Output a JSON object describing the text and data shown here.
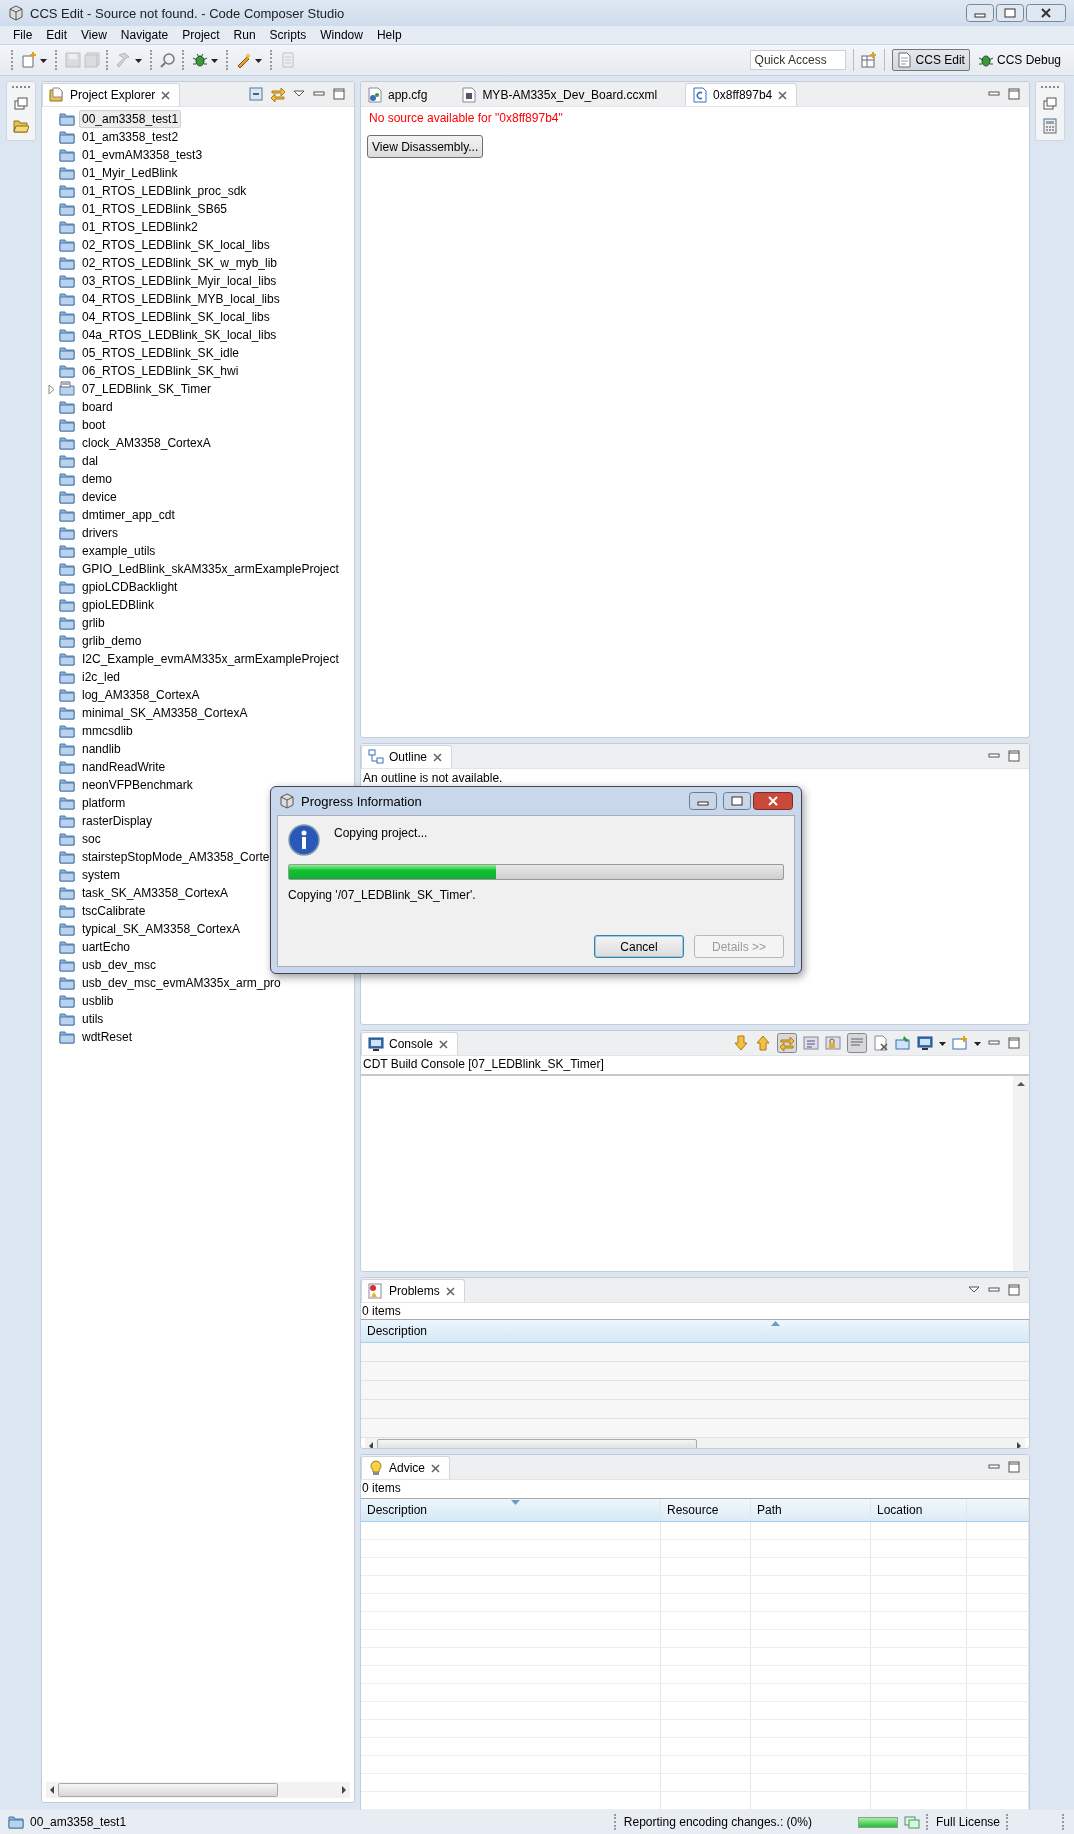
{
  "window": {
    "title": "CCS Edit - Source not found. - Code Composer Studio"
  },
  "menu": [
    "File",
    "Edit",
    "View",
    "Navigate",
    "Project",
    "Run",
    "Scripts",
    "Window",
    "Help"
  ],
  "toolbar": {
    "quick_access": {
      "placeholder": "Quick Access"
    },
    "perspectives": [
      {
        "label": "CCS Edit",
        "kind": "edit",
        "selected": true
      },
      {
        "label": "CCS Debug",
        "kind": "debug",
        "selected": false
      }
    ]
  },
  "project_explorer": {
    "title": "Project Explorer",
    "items": [
      {
        "label": "00_am3358_test1",
        "kind": "folder",
        "selected": true
      },
      {
        "label": "01_am3358_test2",
        "kind": "folder",
        "selected": false
      },
      {
        "label": "01_evmAM3358_test3",
        "kind": "folder",
        "selected": false
      },
      {
        "label": "01_Myir_LedBlink",
        "kind": "folder",
        "selected": false
      },
      {
        "label": "01_RTOS_LEDBlink_proc_sdk",
        "kind": "folder",
        "selected": false
      },
      {
        "label": "01_RTOS_LEDBlink_SB65",
        "kind": "folder",
        "selected": false
      },
      {
        "label": "01_RTOS_LEDBlink2",
        "kind": "folder",
        "selected": false
      },
      {
        "label": "02_RTOS_LEDBlink_SK_local_libs",
        "kind": "folder",
        "selected": false
      },
      {
        "label": "02_RTOS_LEDBlink_SK_w_myb_lib",
        "kind": "folder",
        "selected": false
      },
      {
        "label": "03_RTOS_LEDBlink_Myir_local_libs",
        "kind": "folder",
        "selected": false
      },
      {
        "label": "04_RTOS_LEDBlink_MYB_local_libs",
        "kind": "folder",
        "selected": false
      },
      {
        "label": "04_RTOS_LEDBlink_SK_local_libs",
        "kind": "folder",
        "selected": false
      },
      {
        "label": "04a_RTOS_LEDBlink_SK_local_libs",
        "kind": "folder",
        "selected": false
      },
      {
        "label": "05_RTOS_LEDBlink_SK_idle",
        "kind": "folder",
        "selected": false
      },
      {
        "label": "06_RTOS_LEDBlink_SK_hwi",
        "kind": "folder",
        "selected": false
      },
      {
        "label": "07_LEDBlink_SK_Timer",
        "kind": "project",
        "selected": false,
        "expanded": false
      },
      {
        "label": "board",
        "kind": "folder",
        "selected": false
      },
      {
        "label": "boot",
        "kind": "folder",
        "selected": false
      },
      {
        "label": "clock_AM3358_CortexA",
        "kind": "folder",
        "selected": false
      },
      {
        "label": "dal",
        "kind": "folder",
        "selected": false
      },
      {
        "label": "demo",
        "kind": "folder",
        "selected": false
      },
      {
        "label": "device",
        "kind": "folder",
        "selected": false
      },
      {
        "label": "dmtimer_app_cdt",
        "kind": "folder",
        "selected": false
      },
      {
        "label": "drivers",
        "kind": "folder",
        "selected": false
      },
      {
        "label": "example_utils",
        "kind": "folder",
        "selected": false
      },
      {
        "label": "GPIO_LedBlink_skAM335x_armExampleProject",
        "kind": "folder",
        "selected": false
      },
      {
        "label": "gpioLCDBacklight",
        "kind": "folder",
        "selected": false
      },
      {
        "label": "gpioLEDBlink",
        "kind": "folder",
        "selected": false
      },
      {
        "label": "grlib",
        "kind": "folder",
        "selected": false
      },
      {
        "label": "grlib_demo",
        "kind": "folder",
        "selected": false
      },
      {
        "label": "I2C_Example_evmAM335x_armExampleProject",
        "kind": "folder",
        "selected": false
      },
      {
        "label": "i2c_led",
        "kind": "folder",
        "selected": false
      },
      {
        "label": "log_AM3358_CortexA",
        "kind": "folder",
        "selected": false
      },
      {
        "label": "minimal_SK_AM3358_CortexA",
        "kind": "folder",
        "selected": false
      },
      {
        "label": "mmcsdlib",
        "kind": "folder",
        "selected": false
      },
      {
        "label": "nandlib",
        "kind": "folder",
        "selected": false
      },
      {
        "label": "nandReadWrite",
        "kind": "folder",
        "selected": false
      },
      {
        "label": "neonVFPBenchmark",
        "kind": "folder",
        "selected": false
      },
      {
        "label": "platform",
        "kind": "folder",
        "selected": false
      },
      {
        "label": "rasterDisplay",
        "kind": "folder",
        "selected": false
      },
      {
        "label": "soc",
        "kind": "folder",
        "selected": false
      },
      {
        "label": "stairstepStopMode_AM3358_Corte",
        "kind": "folder",
        "selected": false
      },
      {
        "label": "system",
        "kind": "folder",
        "selected": false
      },
      {
        "label": "task_SK_AM3358_CortexA",
        "kind": "folder",
        "selected": false
      },
      {
        "label": "tscCalibrate",
        "kind": "folder",
        "selected": false
      },
      {
        "label": "typical_SK_AM3358_CortexA",
        "kind": "folder",
        "selected": false
      },
      {
        "label": "uartEcho",
        "kind": "folder",
        "selected": false
      },
      {
        "label": "usb_dev_msc",
        "kind": "folder",
        "selected": false
      },
      {
        "label": "usb_dev_msc_evmAM335x_arm_pro",
        "kind": "folder",
        "selected": false
      },
      {
        "label": "usblib",
        "kind": "folder",
        "selected": false
      },
      {
        "label": "utils",
        "kind": "folder",
        "selected": false
      },
      {
        "label": "wdtReset",
        "kind": "folder",
        "selected": false
      }
    ]
  },
  "editor": {
    "tabs": [
      {
        "label": "app.cfg",
        "kind": "config",
        "selected": false
      },
      {
        "label": "MYB-AM335x_Dev_Board.ccxml",
        "kind": "target",
        "selected": false
      },
      {
        "label": "0x8ff897b4",
        "kind": "source",
        "selected": true
      }
    ],
    "message": "No source available for \"0x8ff897b4\"",
    "button": "View Disassembly..."
  },
  "outline": {
    "title": "Outline",
    "message": "An outline is not available."
  },
  "console": {
    "title": "Console",
    "header": "CDT Build Console [07_LEDBlink_SK_Timer]"
  },
  "problems": {
    "title": "Problems",
    "count": "0 items",
    "columns": [
      "Description"
    ]
  },
  "advice": {
    "title": "Advice",
    "count": "0 items",
    "columns": [
      "Description",
      "Resource",
      "Path",
      "Location"
    ]
  },
  "status_bar": {
    "selection": "00_am3358_test1",
    "task": "Reporting encoding changes.: (0%)",
    "progress": {
      "level": 1
    },
    "license": "Full License"
  },
  "dialog": {
    "title": "Progress Information",
    "message": "Copying project...",
    "progress": {
      "level": 0.42
    },
    "detail": "Copying '/07_LEDBlink_SK_Timer'.",
    "buttons": [
      {
        "label": "Cancel",
        "disabled": false
      },
      {
        "label": "Details >>",
        "disabled": true
      }
    ]
  }
}
